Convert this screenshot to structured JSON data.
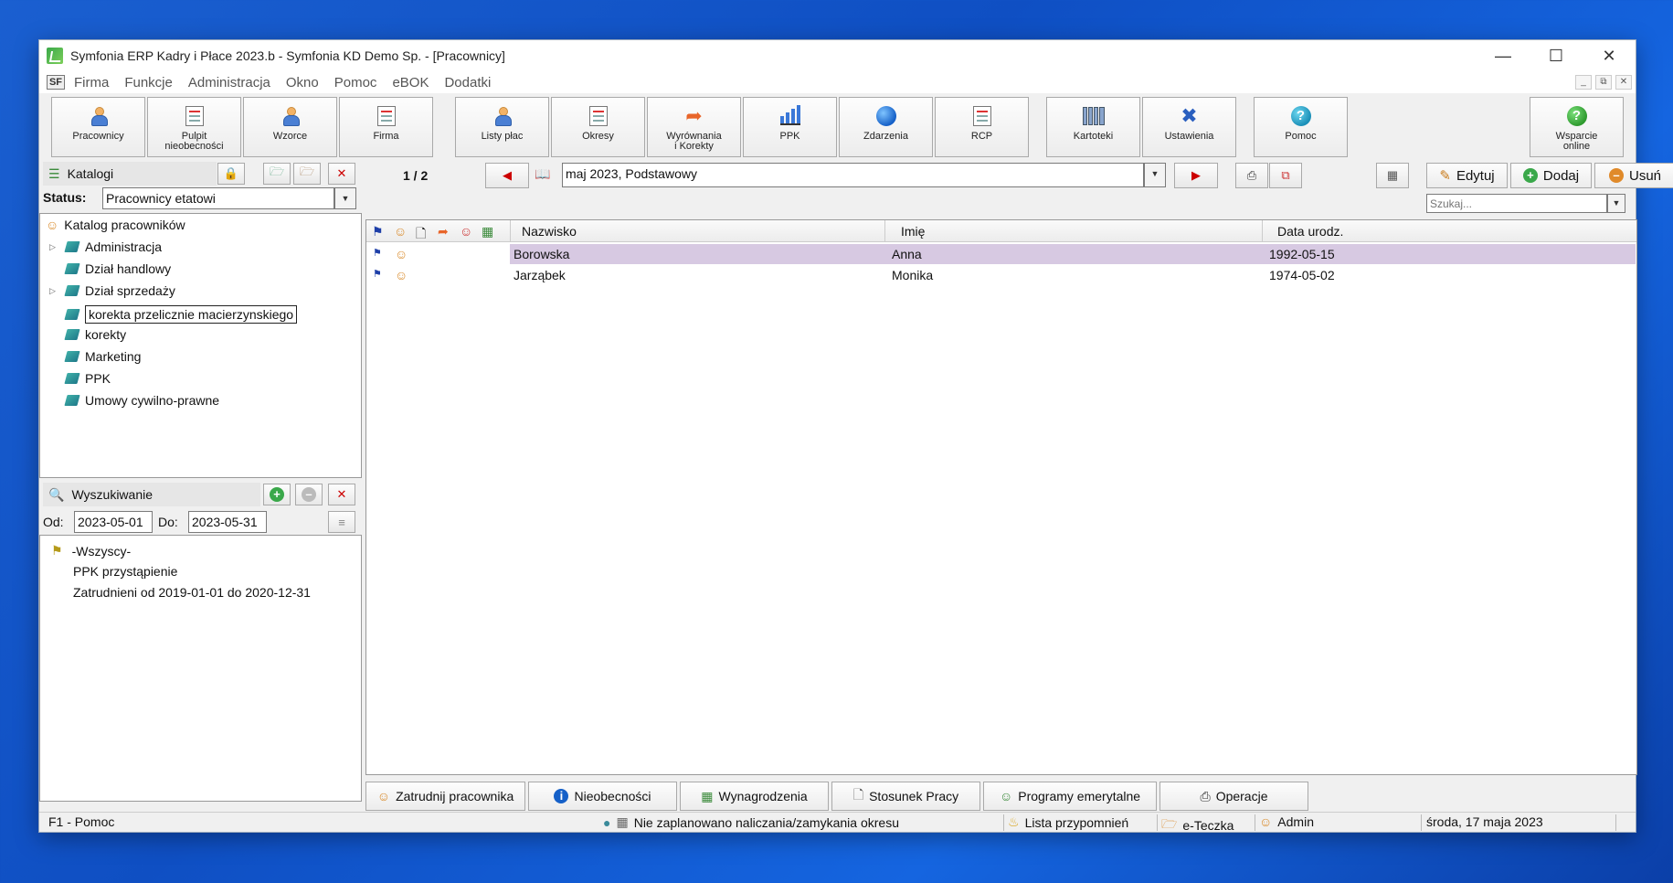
{
  "window": {
    "title": "Symfonia ERP Kadry i Płace 2023.b - Symfonia KD Demo Sp. - [Pracownicy]"
  },
  "menu": [
    "Firma",
    "Funkcje",
    "Administracja",
    "Okno",
    "Pomoc",
    "eBOK",
    "Dodatki"
  ],
  "toolbar": {
    "pracownicy": "Pracownicy",
    "pulpit_1": "Pulpit",
    "pulpit_2": "nieobecności",
    "wzorce": "Wzorce",
    "firma": "Firma",
    "listy_plac": "Listy płac",
    "okresy": "Okresy",
    "wyrownania_1": "Wyrównania",
    "wyrownania_2": "i Korekty",
    "ppk": "PPK",
    "zdarzenia": "Zdarzenia",
    "rcp": "RCP",
    "kartoteki": "Kartoteki",
    "ustawienia": "Ustawienia",
    "pomoc": "Pomoc",
    "wsparcie_1": "Wsparcie",
    "wsparcie_2": "online"
  },
  "catalogs": {
    "header": "Katalogi",
    "status_label": "Status:",
    "status_value": "Pracownicy etatowi",
    "root": "Katalog pracowników",
    "items": [
      "Administracja",
      "Dział handlowy",
      "Dział sprzedaży",
      "korekta przelicznie macierzynskiego",
      "korekty",
      "Marketing",
      "PPK",
      "Umowy cywilno-prawne"
    ]
  },
  "search_panel": {
    "header": "Wyszukiwanie",
    "od_label": "Od:",
    "od_value": "2023-05-01",
    "do_label": "Do:",
    "do_value": "2023-05-31",
    "items": [
      "-Wszyscy-",
      "PPK przystąpienie",
      "Zatrudnieni od 2019-01-01 do 2020-12-31"
    ]
  },
  "period": {
    "page": "1 / 2",
    "value": "maj 2023, Podstawowy"
  },
  "actions": {
    "edit": "Edytuj",
    "add": "Dodaj",
    "delete": "Usuń",
    "search_placeholder": "Szukaj..."
  },
  "grid": {
    "columns": [
      "Nazwisko",
      "Imię",
      "Data urodz."
    ],
    "rows": [
      {
        "nazwisko": "Borowska",
        "imie": "Anna",
        "data": "1992-05-15",
        "selected": true
      },
      {
        "nazwisko": "Jarząbek",
        "imie": "Monika",
        "data": "1974-05-02",
        "selected": false
      }
    ]
  },
  "bottom_tabs": [
    "Zatrudnij pracownika",
    "Nieobecności",
    "Wynagrodzenia",
    "Stosunek Pracy",
    "Programy emerytalne",
    "Operacje"
  ],
  "statusbar": {
    "help": "F1 - Pomoc",
    "message": "Nie zaplanowano naliczania/zamykania okresu",
    "reminders": "Lista przypomnień",
    "eteczka": "e-Teczka",
    "user": "Admin",
    "date": "środa, 17 maja 2023"
  }
}
